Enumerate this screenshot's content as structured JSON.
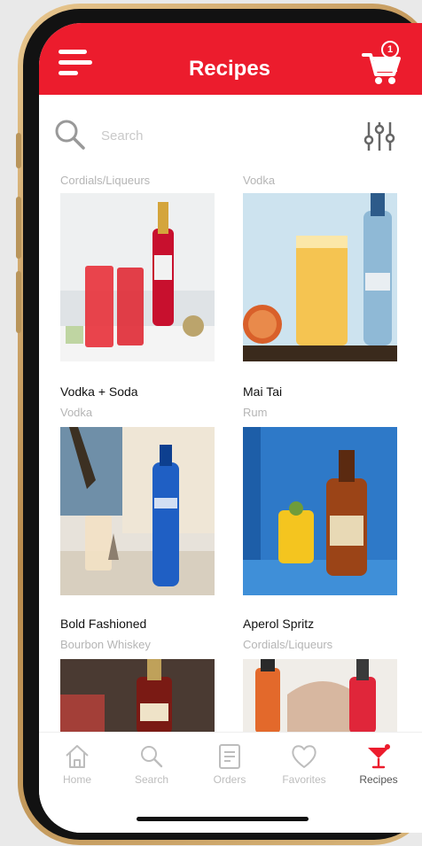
{
  "header": {
    "title": "Recipes",
    "cart_count": "1"
  },
  "search": {
    "placeholder": "Search"
  },
  "recipes": [
    {
      "title": "",
      "category": "Cordials/Liqueurs",
      "image": "campari-red-highball-image"
    },
    {
      "title": "",
      "category": "Vodka",
      "image": "skyy-orange-highball-image"
    },
    {
      "title": "Vodka + Soda",
      "category": "Vodka",
      "image": "skyy-vodka-pour-image"
    },
    {
      "title": "Mai Tai",
      "category": "Rum",
      "image": "appleton-rum-cocktail-image"
    },
    {
      "title": "Bold Fashioned",
      "category": "Bourbon Whiskey",
      "image": "bourbon-bottle-image"
    },
    {
      "title": "Aperol Spritz",
      "category": "Cordials/Liqueurs",
      "image": "aperol-bottle-image"
    }
  ],
  "nav": {
    "items": [
      {
        "label": "Home",
        "icon": "home-icon"
      },
      {
        "label": "Search",
        "icon": "search-icon"
      },
      {
        "label": "Orders",
        "icon": "orders-icon"
      },
      {
        "label": "Favorites",
        "icon": "heart-icon"
      },
      {
        "label": "Recipes",
        "icon": "cocktail-glass-icon",
        "active": true
      }
    ]
  },
  "colors": {
    "brand_red": "#ec1c2d",
    "inactive_gray": "#bdbdbd",
    "category_gray": "#b5b5b5"
  }
}
